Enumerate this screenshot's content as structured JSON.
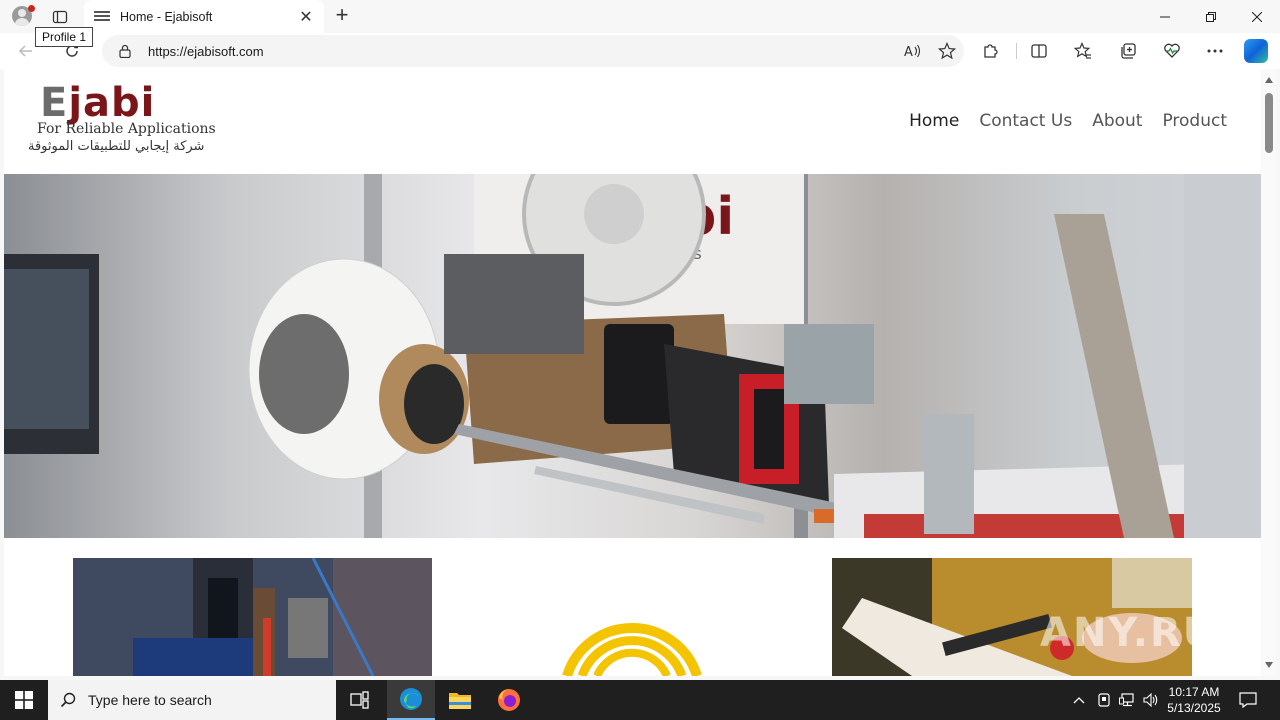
{
  "browser": {
    "tab_title": "Home - Ejabisoft",
    "url": "https://ejabisoft.com",
    "tooltip": "Profile 1",
    "icons": {
      "profile": "profile-icon",
      "tabs": "tab-actions-icon",
      "new_tab": "plus-icon",
      "back": "back-arrow-icon",
      "refresh": "refresh-icon",
      "lock": "lock-icon",
      "read_aloud": "read-aloud-icon",
      "favorite": "star-icon",
      "extensions": "puzzle-icon",
      "split": "split-screen-icon",
      "favorites": "favorites-icon",
      "collections": "collections-icon",
      "performance": "heart-pulse-icon",
      "more": "ellipsis-icon",
      "copilot": "copilot-icon"
    },
    "new_tab_glyph": "+",
    "close_glyph": "✕"
  },
  "site": {
    "logo": {
      "word_first": "E",
      "word_rest": "jabi",
      "tagline": "For Reliable Applications",
      "arabic": "شركة إيجابي للتطبيقات الموثوقة"
    },
    "nav": [
      {
        "label": "Home",
        "active": true
      },
      {
        "label": "Contact Us",
        "active": false
      },
      {
        "label": "About",
        "active": false
      },
      {
        "label": "Product",
        "active": false
      }
    ]
  },
  "watermark": "ANY.RUN",
  "taskbar": {
    "search_placeholder": "Type here to search",
    "time": "10:17 AM",
    "date": "5/13/2025",
    "apps": [
      "task-view-icon",
      "edge-icon",
      "file-explorer-icon",
      "firefox-icon"
    ]
  },
  "colors": {
    "brand_red": "#7a1519",
    "brand_gray": "#6b6b6b",
    "accent_yellow": "#f5c400",
    "taskbar": "#1f1f1f"
  }
}
